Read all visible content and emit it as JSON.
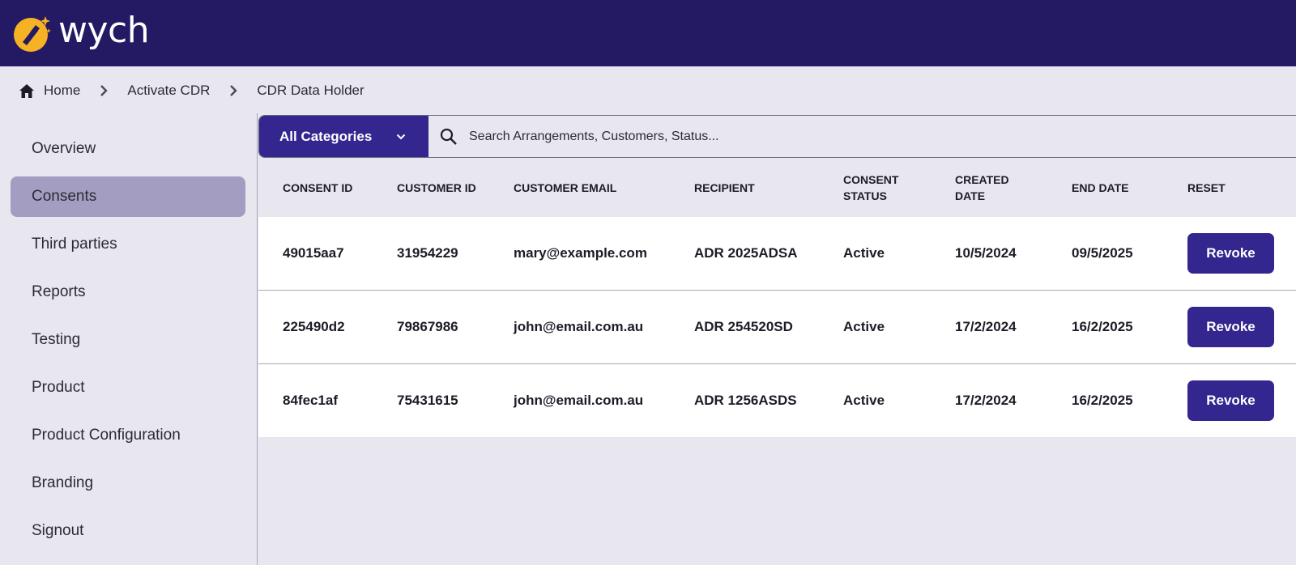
{
  "brand": {
    "name": "wych",
    "logo_color": "#f5b224",
    "bar_color": "#241a64"
  },
  "breadcrumb": [
    {
      "label": "Home",
      "icon": "home-icon"
    },
    {
      "label": "Activate CDR"
    },
    {
      "label": "CDR Data Holder"
    }
  ],
  "sidebar": {
    "items": [
      {
        "label": "Overview",
        "active": false
      },
      {
        "label": "Consents",
        "active": true
      },
      {
        "label": "Third parties",
        "active": false
      },
      {
        "label": "Reports",
        "active": false
      },
      {
        "label": "Testing",
        "active": false
      },
      {
        "label": "Product",
        "active": false
      },
      {
        "label": "Product Configuration",
        "active": false
      },
      {
        "label": "Branding",
        "active": false
      },
      {
        "label": "Signout",
        "active": false
      }
    ]
  },
  "filter": {
    "category_label": "All Categories",
    "search_placeholder": "Search Arrangements, Customers, Status..."
  },
  "table": {
    "columns": [
      "CONSENT ID",
      "CUSTOMER ID",
      "CUSTOMER EMAIL",
      "RECIPIENT",
      "CONSENT STATUS",
      "CREATED DATE",
      "END DATE",
      "RESET"
    ],
    "rows": [
      {
        "consent_id": "49015aa7",
        "customer_id": "31954229",
        "email": "mary@example.com",
        "recipient": "ADR 2025ADSA",
        "status": "Active",
        "created": "10/5/2024",
        "end": "09/5/2025",
        "action": "Revoke"
      },
      {
        "consent_id": "225490d2",
        "customer_id": "79867986",
        "email": "john@email.com.au",
        "recipient": "ADR 254520SD",
        "status": "Active",
        "created": "17/2/2024",
        "end": "16/2/2025",
        "action": "Revoke"
      },
      {
        "consent_id": "84fec1af",
        "customer_id": "75431615",
        "email": "john@email.com.au",
        "recipient": "ADR 1256ASDS",
        "status": "Active",
        "created": "17/2/2024",
        "end": "16/2/2025",
        "action": "Revoke"
      }
    ]
  },
  "colors": {
    "accent": "#33268f",
    "active_nav": "#a39dc2",
    "background": "#e8e6ef"
  }
}
